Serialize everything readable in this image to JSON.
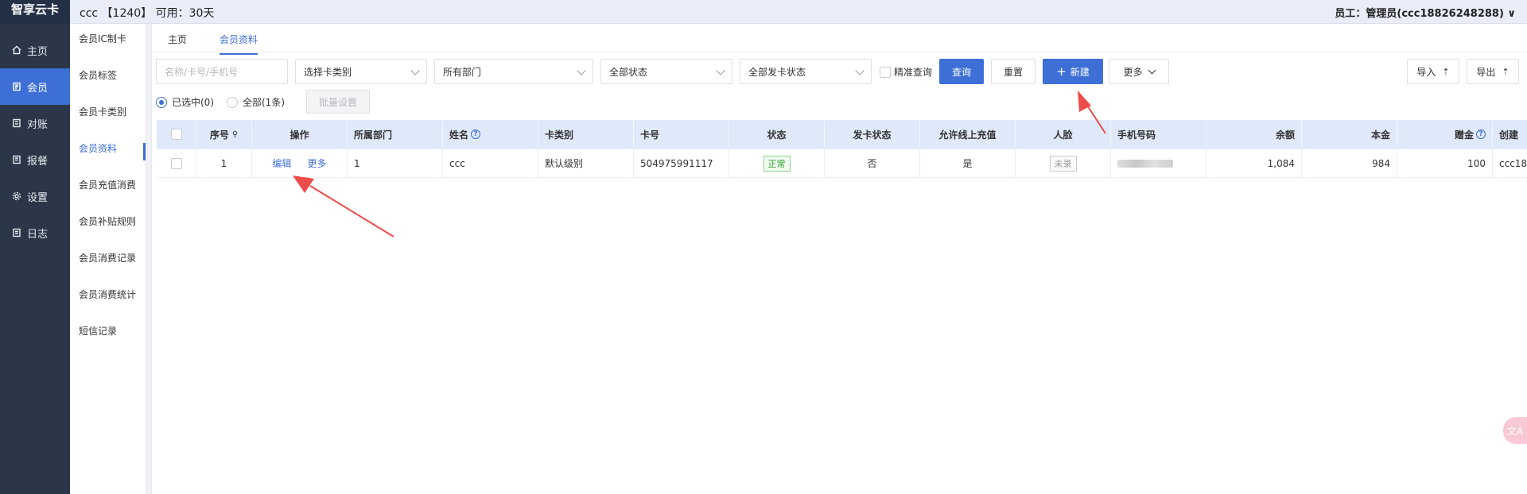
{
  "sidebar": {
    "brand": "智享云卡",
    "items": [
      {
        "label": "主页",
        "icon": "home-icon"
      },
      {
        "label": "会员",
        "icon": "member-icon"
      },
      {
        "label": "对账",
        "icon": "ledger-icon"
      },
      {
        "label": "报餐",
        "icon": "meal-icon"
      },
      {
        "label": "设置",
        "icon": "gear-icon"
      },
      {
        "label": "日志",
        "icon": "log-icon"
      }
    ]
  },
  "header": {
    "info": "ccc 【1240】 可用：30天",
    "user": "员工：管理员(ccc18826248288) ∨"
  },
  "submenu": {
    "items": [
      "会员IC制卡",
      "会员标签",
      "会员卡类别",
      "会员资料",
      "会员充值消费",
      "会员补贴规则",
      "会员消费记录",
      "会员消费统计",
      "短信记录"
    ]
  },
  "tabs": [
    "主页",
    "会员资料"
  ],
  "filters": {
    "search_placeholder": "名称/卡号/手机号",
    "card_type": "选择卡类别",
    "department": "所有部门",
    "status": "全部状态",
    "issue_status": "全部发卡状态",
    "exact_query": "精准查询",
    "query_btn": "查询",
    "reset_btn": "重置",
    "new_btn": "新建",
    "more_btn": "更多",
    "import_btn": "导入",
    "export_btn": "导出"
  },
  "selection": {
    "selected": "已选中(0)",
    "all": "全部(1条)",
    "batch_btn": "批量设置"
  },
  "table": {
    "headers": [
      "序号",
      "操作",
      "所属部门",
      "姓名",
      "卡类别",
      "卡号",
      "状态",
      "发卡状态",
      "允许线上充值",
      "人脸",
      "手机号码",
      "余额",
      "本金",
      "赠金",
      "创建"
    ],
    "row": {
      "index": "1",
      "edit": "编辑",
      "more": "更多",
      "department": "1",
      "name": "ccc",
      "card_type": "默认级别",
      "card_no": "504975991117",
      "status": "正常",
      "issue_status": "否",
      "online_recharge": "是",
      "face": "未录",
      "balance": "1,084",
      "principal": "984",
      "bonus": "100",
      "created": "ccc18"
    }
  },
  "colors": {
    "primary": "#3d6fd6",
    "sidebar": "#2b3648",
    "arrow": "#ee4b4b"
  }
}
